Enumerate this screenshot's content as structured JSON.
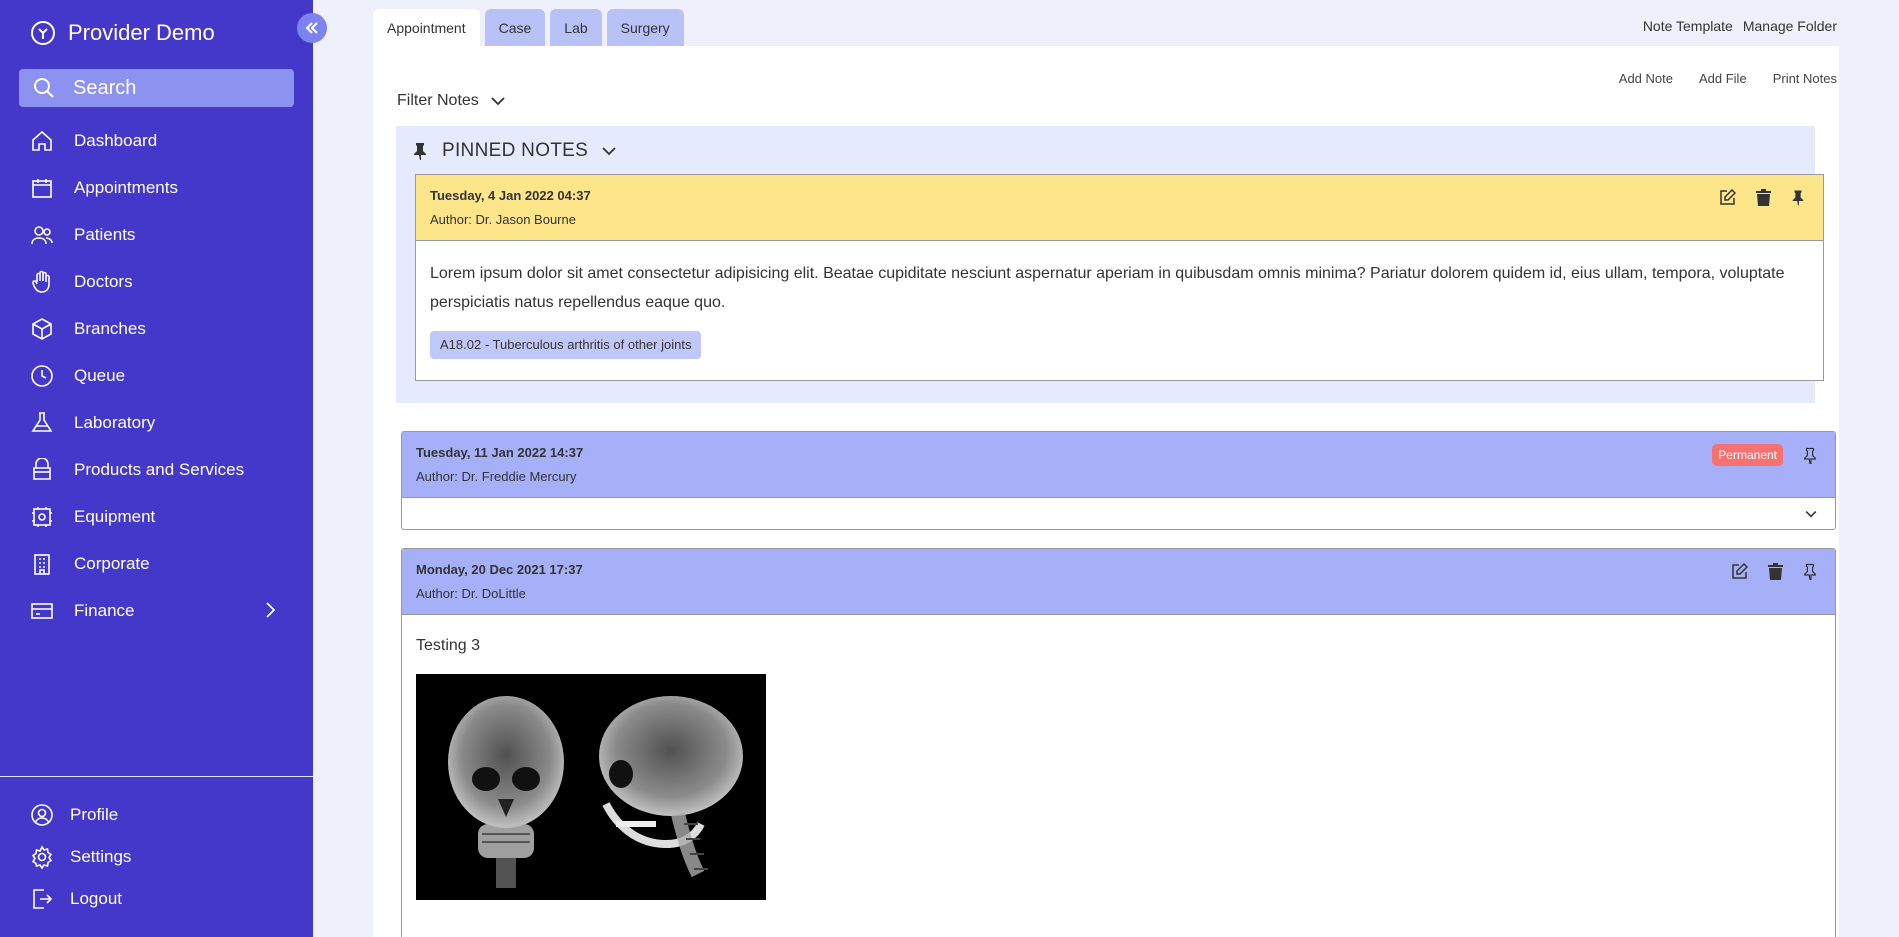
{
  "app": {
    "title": "Provider Demo"
  },
  "search": {
    "placeholder": "Search"
  },
  "nav": {
    "items": [
      {
        "label": "Dashboard",
        "icon": "home-icon"
      },
      {
        "label": "Appointments",
        "icon": "calendar-icon"
      },
      {
        "label": "Patients",
        "icon": "users-icon"
      },
      {
        "label": "Doctors",
        "icon": "hand-icon"
      },
      {
        "label": "Branches",
        "icon": "cube-icon"
      },
      {
        "label": "Queue",
        "icon": "clock-icon"
      },
      {
        "label": "Laboratory",
        "icon": "flask-icon"
      },
      {
        "label": "Products and Services",
        "icon": "box-icon"
      },
      {
        "label": "Equipment",
        "icon": "cog-box-icon"
      },
      {
        "label": "Corporate",
        "icon": "building-icon"
      },
      {
        "label": "Finance",
        "icon": "credit-card-icon"
      }
    ],
    "bottom": [
      {
        "label": "Profile",
        "icon": "user-circle-icon"
      },
      {
        "label": "Settings",
        "icon": "gear-icon"
      },
      {
        "label": "Logout",
        "icon": "logout-icon"
      }
    ]
  },
  "tabs": [
    "Appointment",
    "Case",
    "Lab",
    "Surgery"
  ],
  "top_links": {
    "note_template": "Note Template",
    "manage_folder": "Manage Folder"
  },
  "actions": {
    "add_note": "Add Note",
    "add_file": "Add File",
    "print_notes": "Print Notes"
  },
  "filter": {
    "label": "Filter Notes"
  },
  "pinned": {
    "heading": "PINNED NOTES",
    "note": {
      "date": "Tuesday, 4 Jan 2022 04:37",
      "author": "Author: Dr. Jason Bourne",
      "body": "Lorem ipsum dolor sit amet consectetur adipisicing elit. Beatae cupiditate nesciunt aspernatur aperiam in quibusdam omnis minima? Pariatur dolorem quidem id, eius ullam, tempora, voluptate perspiciatis natus repellendus eaque quo.",
      "tag": "A18.02 - Tuberculous arthritis of other joints"
    }
  },
  "notes": [
    {
      "date": "Tuesday, 11 Jan 2022 14:37",
      "author": "Author: Dr. Freddie Mercury",
      "badge": "Permanent"
    },
    {
      "date": "Monday, 20 Dec 2021 17:37",
      "author": "Author: Dr. DoLittle",
      "body": "Testing 3"
    }
  ],
  "colors": {
    "sidebar": "#4338ca",
    "pinned_header": "#fde68a",
    "note_header": "#a5b0f8",
    "badge": "#f87171"
  }
}
